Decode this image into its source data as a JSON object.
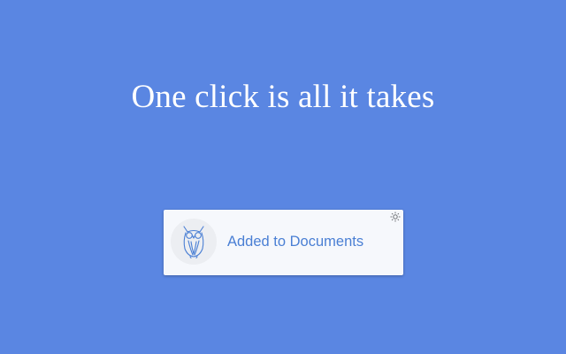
{
  "page": {
    "headline": "One click is all it takes",
    "background_color": "#5a86e2"
  },
  "notification": {
    "message": "Added to Documents",
    "logo_icon": "owl-icon",
    "settings_icon": "gear-icon",
    "text_color": "#4a7fd4"
  }
}
